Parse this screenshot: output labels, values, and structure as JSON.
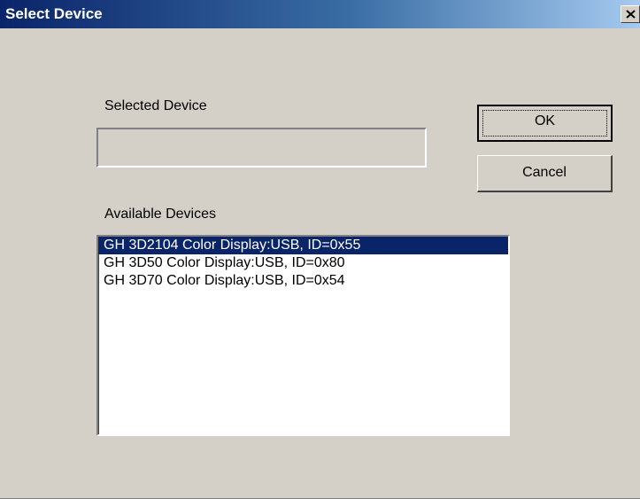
{
  "window": {
    "title": "Select Device",
    "close_icon": "close-x-icon"
  },
  "selected_device": {
    "label": "Selected Device",
    "value": ""
  },
  "buttons": {
    "ok": "OK",
    "cancel": "Cancel"
  },
  "available_devices": {
    "label": "Available Devices",
    "selected_index": 0,
    "items": [
      "GH 3D2104 Color Display:USB, ID=0x55",
      "GH 3D50 Color Display:USB, ID=0x80",
      "GH 3D70 Color Display:USB, ID=0x54"
    ]
  },
  "colors": {
    "dialog_face": "#d4d0c8",
    "title_gradient_start": "#0a246a",
    "title_gradient_end": "#a6caf0",
    "selection": "#0a246a"
  }
}
